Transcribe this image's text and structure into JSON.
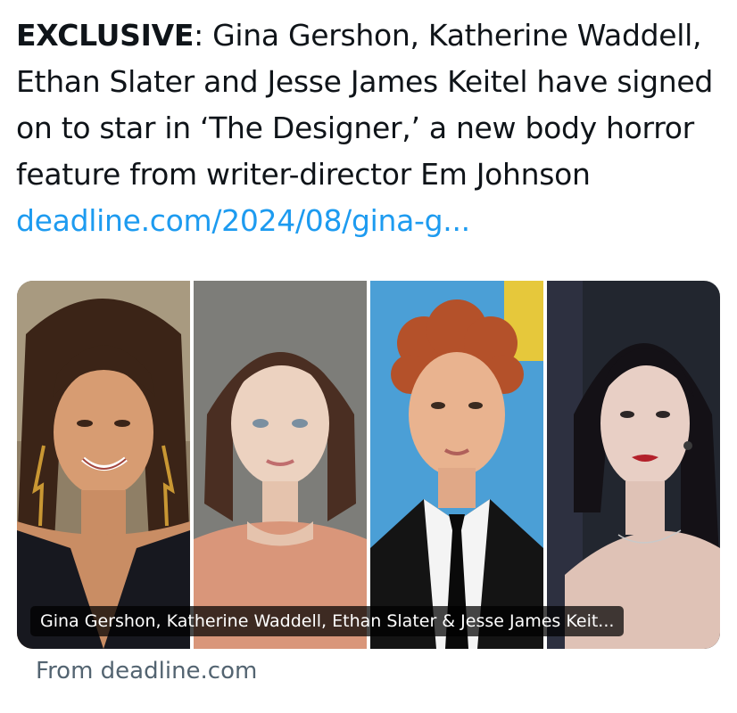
{
  "tweet": {
    "lead": "EXCLUSIVE",
    "separator": ":",
    "body": " Gina Gershon, Katherine Waddell, Ethan Slater and Jesse James Keitel have signed on to star in ‘The Designer,’ a new body horror feature from writer-director Em Johnson ",
    "link_text": "deadline.com/2024/08/gina-g..."
  },
  "card": {
    "caption": "Gina Gershon, Katherine Waddell, Ethan Slater & Jesse James Keit...",
    "source": "From deadline.com"
  },
  "colors": {
    "text": "#0f1419",
    "link": "#1d9bf0",
    "secondary": "#536471"
  }
}
